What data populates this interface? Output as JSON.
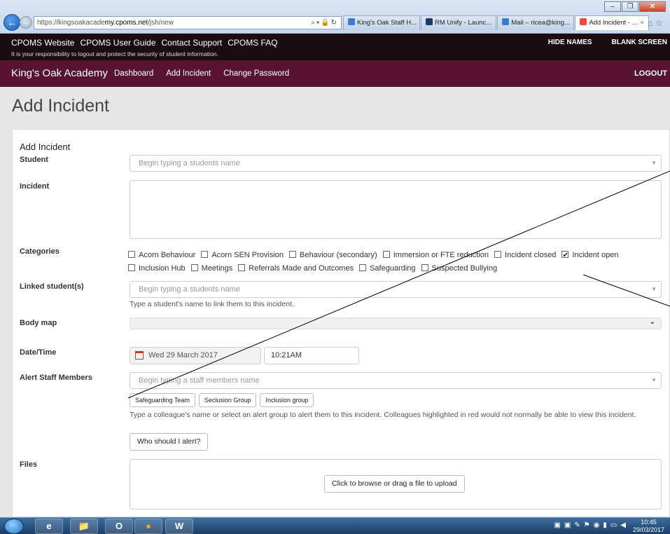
{
  "browser": {
    "url_prefix": "https://kingsoakacade",
    "url_host": "my.cpoms.net",
    "url_path": "/jsh/new",
    "tabs": [
      {
        "label": "King's Oak Staff H...",
        "color": "#3b7bd4"
      },
      {
        "label": "RM Unify - Launc...",
        "color": "#1a3a6b"
      },
      {
        "label": "Mail – ricea@king...",
        "color": "#3b7bd4"
      },
      {
        "label": "Add Incident - ...",
        "color": "#e84c3d"
      }
    ],
    "active_tab_close": "×"
  },
  "cpoms_header": {
    "links": [
      "CPOMS Website",
      "CPOMS User Guide",
      "Contact Support",
      "CPOMS FAQ"
    ],
    "notice": "It is your responsibility to logout and protect the security of student information.",
    "hide_names": "HIDE NAMES",
    "blank_screen": "BLANK SCREEN"
  },
  "nav": {
    "brand": "King's Oak Academy",
    "links": [
      "Dashboard",
      "Add Incident",
      "Change Password"
    ],
    "logout": "LOGOUT"
  },
  "page_title": "Add Incident",
  "form": {
    "panel_title": "Add Incident",
    "student_label": "Student",
    "student_placeholder": "Begin typing a students name",
    "incident_label": "Incident",
    "categories_label": "Categories",
    "categories": [
      {
        "label": "Acorn Behaviour",
        "checked": false
      },
      {
        "label": "Acorn SEN Provision",
        "checked": false
      },
      {
        "label": "Behaviour (secondary)",
        "checked": false
      },
      {
        "label": "Immersion or FTE reduction",
        "checked": false
      },
      {
        "label": "Incident closed",
        "checked": false
      },
      {
        "label": "Incident open",
        "checked": true
      },
      {
        "label": "Inclusion Hub",
        "checked": false
      },
      {
        "label": "Meetings",
        "checked": false
      },
      {
        "label": "Referrals Made and Outcomes",
        "checked": false
      },
      {
        "label": "Safeguarding",
        "checked": false
      },
      {
        "label": "Suspected Bullying",
        "checked": false
      }
    ],
    "linked_label": "Linked student(s)",
    "linked_placeholder": "Begin typing a students name",
    "linked_help": "Type a student's name to link them to this incident.",
    "bodymap_label": "Body map",
    "datetime_label": "Date/Time",
    "date_value": "Wed 29 March 2017",
    "time_value": "10:21AM",
    "alert_label": "Alert Staff Members",
    "alert_placeholder": "Begin typing a staff members name",
    "groups": [
      "Safeguarding Team",
      "Seclusion Group",
      "Inclusion group"
    ],
    "alert_help": "Type a colleague's name or select an alert group to alert them to this incident. Colleagues highlighted in red would not normally be able to view this incident.",
    "who_button": "Who should I alert?",
    "files_label": "Files",
    "upload_button": "Click to browse or drag a file to upload"
  },
  "taskbar": {
    "apps": [
      "e",
      "📁",
      "O",
      "●",
      "W"
    ],
    "time": "10:45",
    "date": "29/03/2017"
  }
}
